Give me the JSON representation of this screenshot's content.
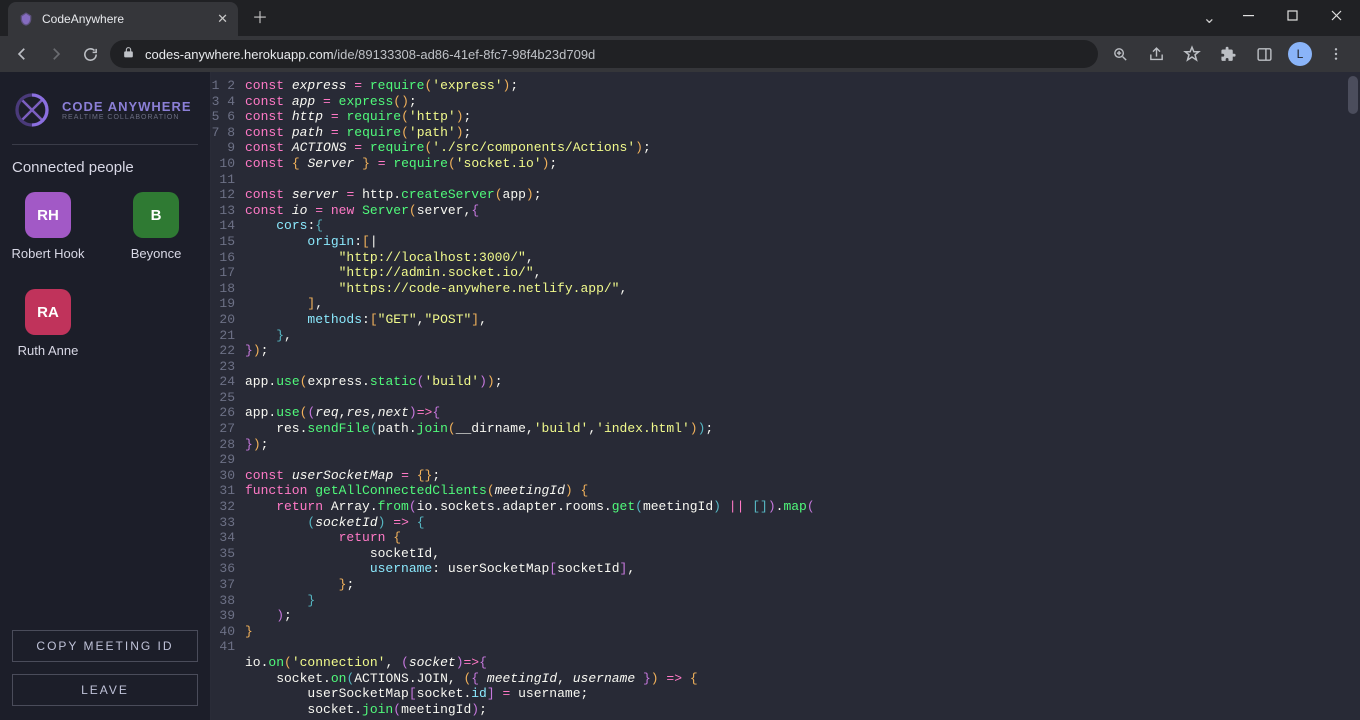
{
  "browser": {
    "tab_title": "CodeAnywhere",
    "url_domain": "codes-anywhere.herokuapp.com",
    "url_path": "/ide/89133308-ad86-41ef-8fc7-98f4b23d709d",
    "avatar_initial": "L"
  },
  "brand": {
    "name": "CODE ANYWHERE",
    "sub": "REALTIME COLLABORATION"
  },
  "sidebar": {
    "section_title": "Connected people",
    "users": [
      {
        "initials": "RH",
        "name": "Robert Hook",
        "color": "#a259c6"
      },
      {
        "initials": "B",
        "name": "Beyonce",
        "color": "#2f7a33"
      },
      {
        "initials": "RA",
        "name": "Ruth Anne",
        "color": "#c0335b"
      }
    ],
    "copy_btn": "COPY MEETING ID",
    "leave_btn": "LEAVE"
  },
  "editor": {
    "first_line": 1,
    "last_line": 41
  }
}
